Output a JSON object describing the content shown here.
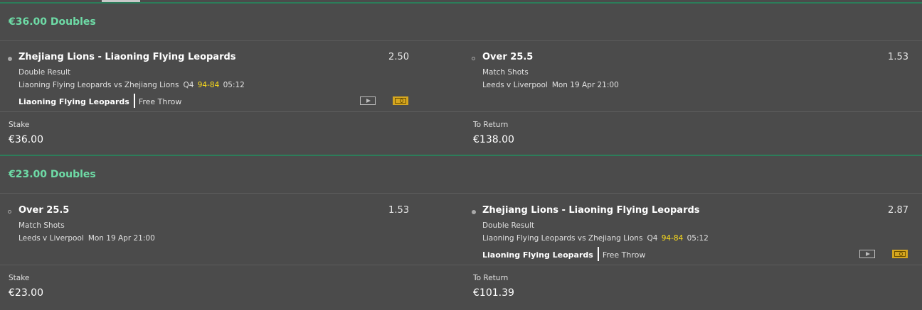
{
  "bets": [
    {
      "title": "€36.00 Doubles",
      "selections": [
        {
          "bullet": "filled",
          "name": "Zhejiang Lions - Liaoning Flying Leopards",
          "odds": "2.50",
          "market": "Double Result",
          "event": "Liaoning Flying Leopards vs Zhejiang Lions",
          "period": "Q4",
          "score": "94-84",
          "clock": "05:12",
          "team": "Liaoning Flying Leopards",
          "incident": "Free Throw",
          "icons": [
            "video-play-icon",
            "match-pitch-icon"
          ]
        },
        {
          "bullet": "hollow",
          "name": "Over 25.5",
          "odds": "1.53",
          "market": "Match Shots",
          "event": "Leeds v Liverpool",
          "datetime": "Mon 19 Apr 21:00"
        }
      ],
      "stake_label": "Stake",
      "stake": "€36.00",
      "return_label": "To Return",
      "to_return": "€138.00"
    },
    {
      "title": "€23.00 Doubles",
      "selections": [
        {
          "bullet": "hollow",
          "name": "Over 25.5",
          "odds": "1.53",
          "market": "Match Shots",
          "event": "Leeds v Liverpool",
          "datetime": "Mon 19 Apr 21:00"
        },
        {
          "bullet": "filled",
          "name": "Zhejiang Lions - Liaoning Flying Leopards",
          "odds": "2.87",
          "market": "Double Result",
          "event": "Liaoning Flying Leopards vs Zhejiang Lions",
          "period": "Q4",
          "score": "94-84",
          "clock": "05:12",
          "team": "Liaoning Flying Leopards",
          "incident": "Free Throw",
          "icons": [
            "video-play-icon",
            "match-pitch-icon"
          ]
        }
      ],
      "stake_label": "Stake",
      "stake": "€23.00",
      "return_label": "To Return",
      "to_return": "€101.39"
    }
  ],
  "colors": {
    "background": "#4b4b4b",
    "accent_green": "#6edba6",
    "divider_green": "#2c7d5a",
    "score_yellow": "#ffdf1b",
    "pitch_icon": "#d5a61f"
  }
}
